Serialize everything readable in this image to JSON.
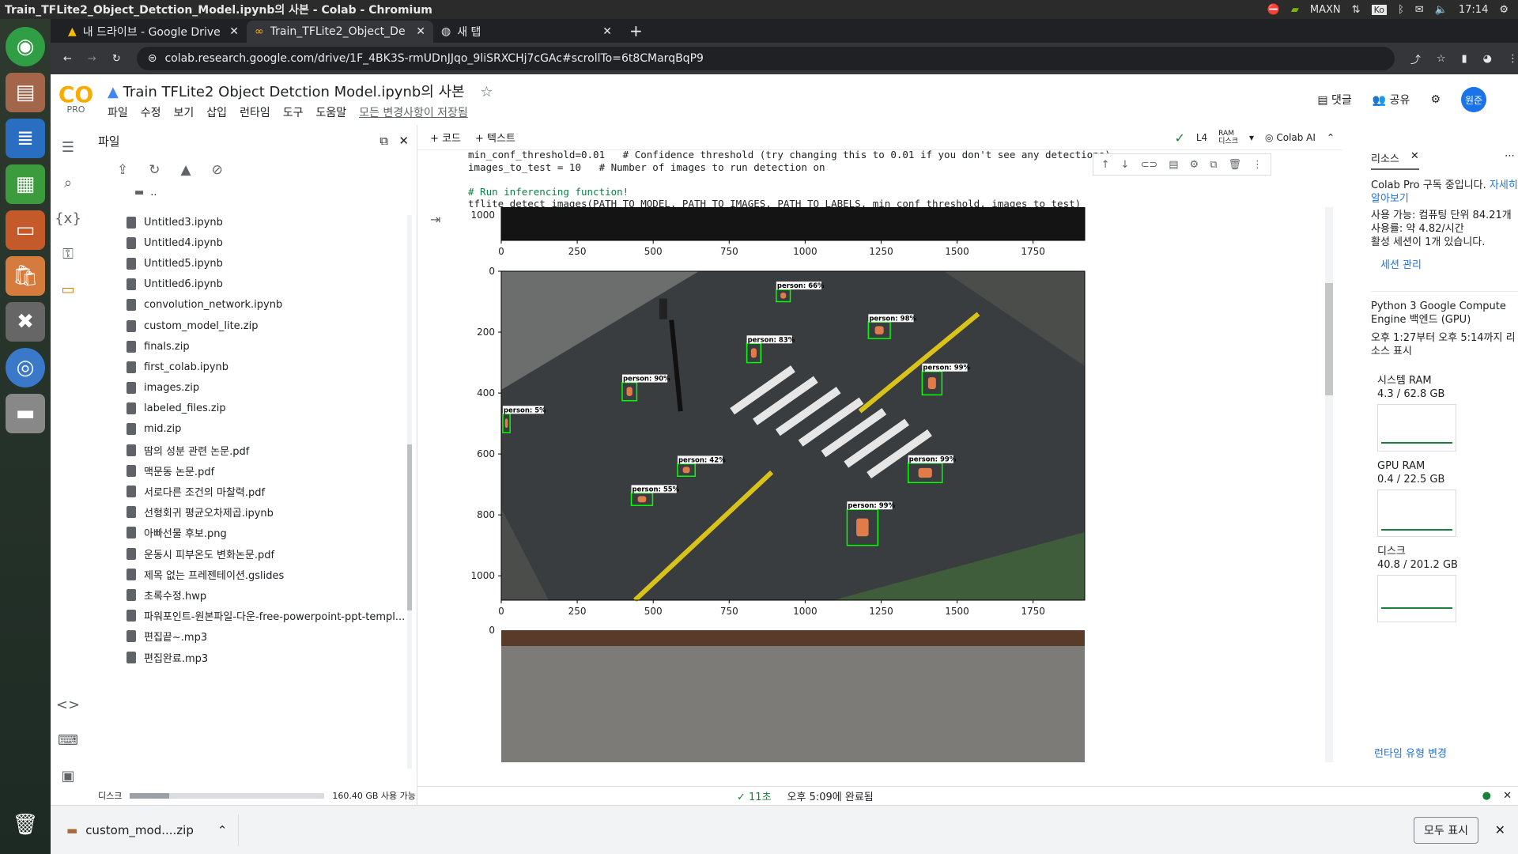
{
  "window_title": "Train_TFLite2_Object_Detction_Model.ipynb의 사본 - Colab - Chromium",
  "system": {
    "maxn": "MAXN",
    "ime": "Ko",
    "clock": "17:14"
  },
  "tabs": [
    {
      "label": "내 드라이브 - Google Drive"
    },
    {
      "label": "Train_TFLite2_Object_De"
    },
    {
      "label": "새 탭"
    }
  ],
  "url": "colab.research.google.com/drive/1F_4BK3S-rmUDnJJqo_9liSRXCHj7cGAc#scrollTo=6t8CMarqBqP9",
  "colab": {
    "logo": "CO",
    "pro": "PRO",
    "title": "Train TFLite2 Object Detction Model.ipynb의 사본",
    "menu": [
      "파일",
      "수정",
      "보기",
      "삽입",
      "런타임",
      "도구",
      "도움말"
    ],
    "saved": "모든 변경사항이 저장됨",
    "comment": "댓글",
    "share": "공유",
    "avatar": "원준"
  },
  "files": {
    "title": "파일",
    "parent": "..",
    "items": [
      "Untitled3.ipynb",
      "Untitled4.ipynb",
      "Untitled5.ipynb",
      "Untitled6.ipynb",
      "convolution_network.ipynb",
      "custom_model_lite.zip",
      "finals.zip",
      "first_colab.ipynb",
      "images.zip",
      "labeled_files.zip",
      "mid.zip",
      "땀의 성분 관련 논문.pdf",
      "맥문동 논문.pdf",
      "서로다른 조건의 마찰력.pdf",
      "선형회귀 평균오차제곱.ipynb",
      "아빠선물 후보.png",
      "운동시 피부온도 변화논문.pdf",
      "제목 없는 프레젠테이션.gslides",
      "초록수정.hwp",
      "파워포인트-원본파일-다운-free-powerpoint-ppt-templ...",
      "편집끝~.mp3",
      "편집완료.mp3"
    ],
    "disk_label": "디스크",
    "disk_text": "160.40 GB 사용 가능",
    "disk_used_fraction": 0.2
  },
  "toolbar": {
    "code": "+ 코드",
    "text": "+ 텍스트",
    "gpu": "L4",
    "ram": "RAM",
    "disk": "디스크",
    "ai": "Colab AI"
  },
  "code_lines": [
    {
      "t": "min_conf_threshold=0.01   # Confidence threshold (try changing this to 0.01 if you don't see any detections)",
      "c": false
    },
    {
      "t": "images_to_test = 10   # Number of images to run detection on",
      "c": false
    },
    {
      "t": "",
      "c": false
    },
    {
      "t": "# Run inferencing function!",
      "c": true
    },
    {
      "t": "tflite_detect_images(PATH_TO_MODEL, PATH_TO_IMAGES, PATH_TO_LABELS, min_conf_threshold, images_to_test)",
      "c": false
    }
  ],
  "plot": {
    "xticks": [
      "0",
      "250",
      "500",
      "750",
      "1000",
      "1250",
      "1500",
      "1750"
    ],
    "yticks": [
      "0",
      "200",
      "400",
      "600",
      "800",
      "1000"
    ],
    "top_ytick": "1000",
    "bottom_ytick": "0",
    "detections": [
      {
        "label": "person: 66%",
        "x": 905,
        "y": 60,
        "w": 46,
        "h": 40
      },
      {
        "label": "person: 98%",
        "x": 1208,
        "y": 167,
        "w": 72,
        "h": 54
      },
      {
        "label": "person: 83%",
        "x": 808,
        "y": 237,
        "w": 46,
        "h": 63
      },
      {
        "label": "person: 99%",
        "x": 1385,
        "y": 329,
        "w": 65,
        "h": 77
      },
      {
        "label": "person: 90%",
        "x": 398,
        "y": 365,
        "w": 48,
        "h": 60
      },
      {
        "label": "person: 5%",
        "x": 5,
        "y": 468,
        "w": 24,
        "h": 62
      },
      {
        "label": "person: 42%",
        "x": 580,
        "y": 632,
        "w": 58,
        "h": 41
      },
      {
        "label": "person: 99%",
        "x": 1339,
        "y": 630,
        "w": 112,
        "h": 64
      },
      {
        "label": "person: 55%",
        "x": 428,
        "y": 728,
        "w": 70,
        "h": 41
      },
      {
        "label": "person: 99%",
        "x": 1138,
        "y": 782,
        "w": 101,
        "h": 118
      }
    ]
  },
  "status": {
    "check": "✓ 11초",
    "text": "오후 5:09에 완료됨"
  },
  "resources": {
    "tab": "리소스",
    "pro_text": "Colab Pro 구독 중입니다.",
    "more": "자세히 알아보기",
    "avail": "사용 가능: 컴퓨팅 단위 84.21개",
    "usage": "사용률: 약 4.82/시간",
    "sessions": "활성 세션이 1개 있습니다.",
    "manage": "세션 관리",
    "engine": "Python 3 Google Compute Engine 백엔드 (GPU)",
    "time": "오후 1:27부터 오후 5:14까지 리소스 표시",
    "meters": [
      {
        "name": "시스템 RAM",
        "value": "4.3 / 62.8 GB",
        "level": 0.07
      },
      {
        "name": "GPU RAM",
        "value": "0.4 / 22.5 GB",
        "level": 0.02
      },
      {
        "name": "디스크",
        "value": "40.8 / 201.2 GB",
        "level": 0.2
      }
    ],
    "change": "런타임 유형 변경"
  },
  "download": {
    "file": "custom_mod....zip",
    "show_all": "모두 표시"
  },
  "colors": {
    "accent": "#1a73e8",
    "bbox": "#00ff00",
    "road": "#3a3d3f"
  }
}
